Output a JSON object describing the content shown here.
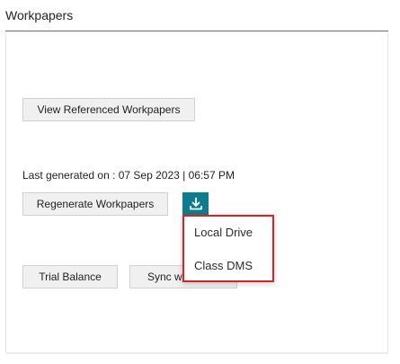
{
  "header": {
    "title": "Workpapers"
  },
  "actions": {
    "view_referenced_label": "View Referenced Workpapers",
    "last_generated_text": "Last generated on : 07 Sep 2023 | 06:57 PM",
    "regenerate_label": "Regenerate Workpapers",
    "download_icon": "download-icon",
    "trial_balance_label": "Trial Balance",
    "sync_label": "Sync wi"
  },
  "download_menu": {
    "items": [
      {
        "label": "Local Drive"
      },
      {
        "label": "Class DMS"
      }
    ]
  },
  "colors": {
    "accent": "#0e7b8f",
    "highlight_border": "#e02020",
    "button_bg": "#f0f0f0"
  }
}
